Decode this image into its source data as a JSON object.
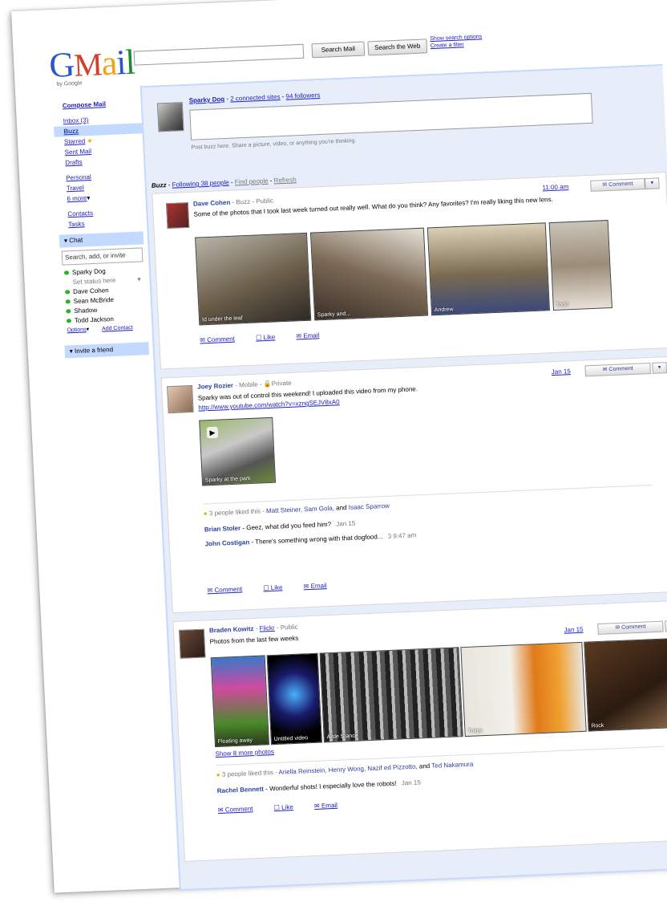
{
  "app": {
    "logo": "Gmail",
    "logo_sub": "by Google",
    "search_mail": "Search Mail",
    "search_web": "Search the Web",
    "show_options": "Show search options",
    "create_filter": "Create a filter"
  },
  "nav": {
    "compose": "Compose Mail",
    "items": [
      "Inbox (3)",
      "Buzz",
      "Starred",
      "Sent Mail",
      "Drafts"
    ],
    "labels": [
      "Personal",
      "Travel",
      "6 more"
    ],
    "contacts": "Contacts",
    "tasks": "Tasks",
    "chat_header": "Chat",
    "chat_search_placeholder": "Search, add, or invite",
    "me": "Sparky Dog",
    "status": "Set status here",
    "contacts_list": [
      "Dave Cohen",
      "Sean McBride",
      "Shadow",
      "Todd Jackson"
    ],
    "options": "Options",
    "add_contact": "Add Contact",
    "invite": "Invite a friend"
  },
  "composer": {
    "name": "Sparky Dog",
    "sites": "2 connected sites",
    "followers": "94 followers",
    "hint": "Post buzz here. Share a picture, video, or anything you're thinking."
  },
  "buzzbar": {
    "title": "Buzz",
    "following": "Following 38 people",
    "find": "Find people",
    "refresh": "Refresh"
  },
  "posts": [
    {
      "author": "Dave Cohen",
      "via": "Buzz",
      "visibility": "Public",
      "time": "11:00 am",
      "text": "Some of the photos that I took last week turned out really well. What do you think? Any favorites? I'm really liking this new lens.",
      "captions": [
        "Id under the leaf",
        "Sparky and...",
        "Andrew",
        "Todd"
      ],
      "comment": "Comment",
      "like": "Like",
      "email": "Email"
    },
    {
      "author": "Joey Rozier",
      "via": "Mobile",
      "visibility": "Private",
      "time": "Jan 15",
      "text": "Sparky was out of control this weekend! I uploaded this video from my phone.",
      "link": "http://www.youtube.com/watch?v=xzngSEJV8xA0",
      "video_caption": "Sparky at the park",
      "likes": "3 people liked this -",
      "likers": "Matt Steiner, Sam Gola,",
      "likers_and": "and",
      "likers_last": "Isaac Sparrow",
      "comments": [
        {
          "author": "Brian Stoler",
          "text": "- Geez, what did you feed him?",
          "time": "Jan 15"
        },
        {
          "author": "John Costigan",
          "text": "- There's something wrong with that dogfood...",
          "time": "3  9:47 am"
        }
      ],
      "comment": "Comment",
      "like": "Like",
      "email": "Email"
    },
    {
      "author": "Braden Kowitz",
      "via": "Flickr",
      "visibility": "Public",
      "time": "Jan 15",
      "text": "Photos from the last few weeks",
      "captions": [
        "Floating away",
        "Untitled video",
        "Aisle Stance",
        "Tulips",
        "Rock"
      ],
      "more": "Show 8 more photos",
      "likes": "3 people liked this -",
      "likers": "Ariella Reinstein, Henry Wong, Nazif ed Pizzotto,",
      "likers_and": "and",
      "likers_last": "Ted Nakamura",
      "comments": [
        {
          "author": "Rachel Bennett",
          "text": "- Wonderful shots! I especially love the robots!",
          "time": "Jan 15"
        }
      ],
      "comment": "Comment",
      "like": "Like",
      "email": "Email"
    }
  ]
}
